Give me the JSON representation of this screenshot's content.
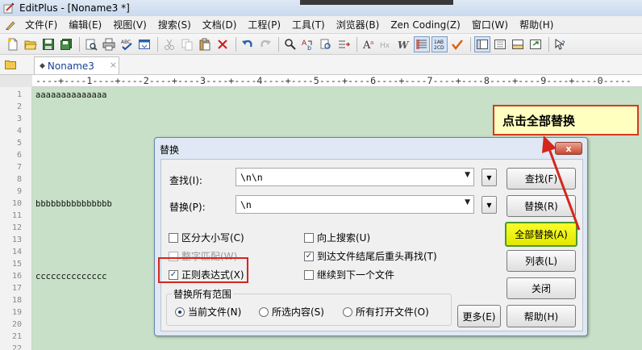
{
  "window": {
    "title": "EditPlus - [Noname3 *]"
  },
  "menu": {
    "items": [
      "文件(F)",
      "编辑(E)",
      "视图(V)",
      "搜索(S)",
      "文档(D)",
      "工程(P)",
      "工具(T)",
      "浏览器(B)",
      "Zen Coding(Z)",
      "窗口(W)",
      "帮助(H)"
    ]
  },
  "tab": {
    "label": "Noname3",
    "close": "×"
  },
  "ruler": {
    "text": "----+----1----+----2----+----3----+----4----+----5----+----6----+----7----+----8----+----9----+----0-----"
  },
  "editor": {
    "line_numbers": [
      "1",
      "2",
      "3",
      "4",
      "5",
      "6",
      "7",
      "8",
      "9",
      "10",
      "11",
      "12",
      "13",
      "14",
      "15",
      "16",
      "17",
      "18",
      "19",
      "20",
      "21",
      "22"
    ],
    "lines": [
      {
        "n": 1,
        "text": "aaaaaaaaaaaaaa"
      },
      {
        "n": 10,
        "text": "bbbbbbbbbbbbbbb"
      },
      {
        "n": 16,
        "text": "cccccccccccccc"
      }
    ],
    "background": "#c7e0c7"
  },
  "dialog": {
    "title": "替换",
    "close_label": "x",
    "find_label": "查找(I):",
    "find_value": "\\n\\n",
    "replace_label": "替换(P):",
    "replace_value": "\\n",
    "ext_button": "▼",
    "checkboxes": {
      "case": {
        "label": "区分大小写(C)",
        "checked": false
      },
      "whole_word": {
        "label": "整字匹配(W)",
        "checked": false,
        "disabled": true
      },
      "regex": {
        "label": "正则表达式(X)",
        "checked": true
      },
      "search_up": {
        "label": "向上搜索(U)",
        "checked": false
      },
      "wrap": {
        "label": "到达文件结尾后重头再找(T)",
        "checked": true
      },
      "next_file": {
        "label": "继续到下一个文件",
        "checked": false
      }
    },
    "scope": {
      "title": "替换所有范围",
      "options": [
        {
          "label": "当前文件(N)",
          "selected": true
        },
        {
          "label": "所选内容(S)",
          "selected": false
        },
        {
          "label": "所有打开文件(O)",
          "selected": false
        }
      ]
    },
    "buttons": {
      "find": "查找(F)",
      "replace": "替换(R)",
      "replace_all": "全部替换(A)",
      "list": "列表(L)",
      "close": "关闭",
      "more": "更多(E)",
      "help": "帮助(H)"
    }
  },
  "callout": {
    "text": "点击全部替换"
  },
  "colors": {
    "highlight_red": "#d4261c",
    "primary_button": "#f9fd2a",
    "callout_bg": "#ffffc0"
  }
}
